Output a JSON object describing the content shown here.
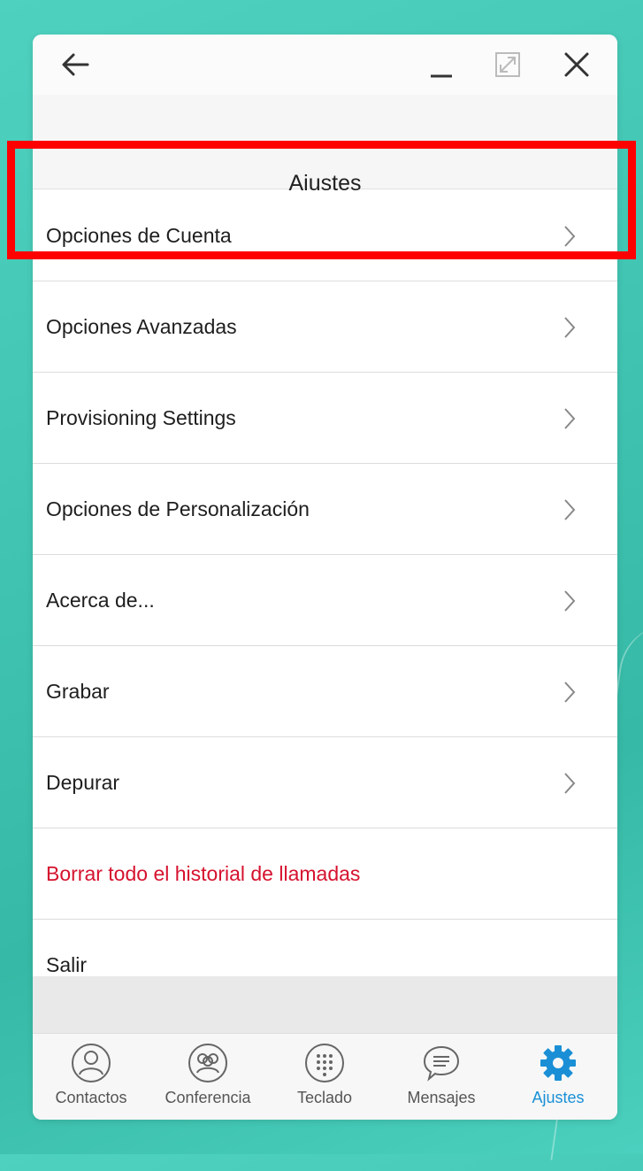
{
  "window": {
    "title": "Ajustes",
    "controls": {
      "back": "back-arrow-icon",
      "minimize": "minimize-icon",
      "maximize": "maximize-icon",
      "close": "close-icon"
    }
  },
  "menu": {
    "items": [
      {
        "label": "Opciones de Cuenta",
        "has_chevron": true
      },
      {
        "label": "Opciones Avanzadas",
        "has_chevron": true
      },
      {
        "label": "Provisioning Settings",
        "has_chevron": true
      },
      {
        "label": "Opciones de Personalización",
        "has_chevron": true
      },
      {
        "label": "Acerca de...",
        "has_chevron": true
      },
      {
        "label": "Grabar",
        "has_chevron": true
      },
      {
        "label": "Depurar",
        "has_chevron": true
      },
      {
        "label": "Borrar todo el historial de llamadas",
        "has_chevron": false
      },
      {
        "label": "Salir",
        "has_chevron": false
      }
    ],
    "danger_color": "#d6122e"
  },
  "tabs": [
    {
      "label": "Contactos",
      "icon": "contact-icon",
      "active": false
    },
    {
      "label": "Conferencia",
      "icon": "conference-icon",
      "active": false
    },
    {
      "label": "Teclado",
      "icon": "keypad-icon",
      "active": false
    },
    {
      "label": "Mensajes",
      "icon": "message-icon",
      "active": false
    },
    {
      "label": "Ajustes",
      "icon": "settings-gear-icon",
      "active": true
    }
  ],
  "colors": {
    "accent": "#1a8fd6",
    "highlight": "#ff0000",
    "background": "#3fc2b0"
  }
}
